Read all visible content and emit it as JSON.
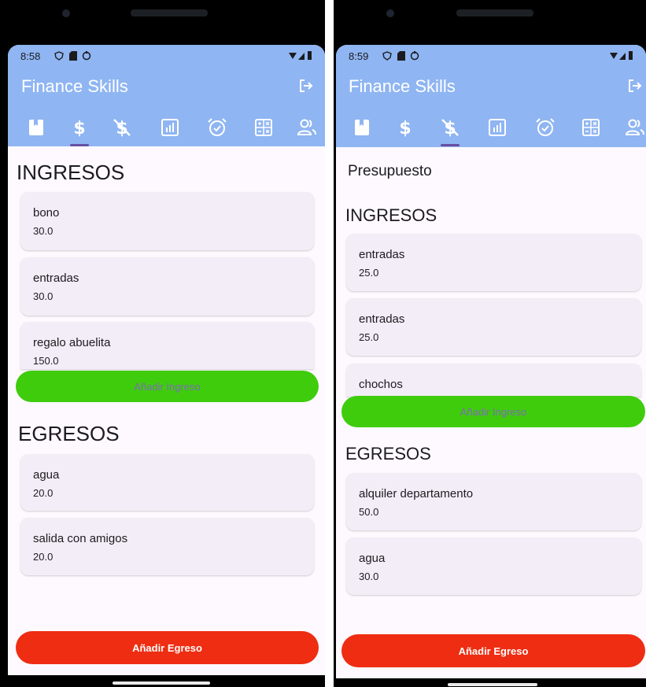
{
  "screens": [
    {
      "status_time": "8:58",
      "app_title": "Finance Skills",
      "tabs": [
        "book",
        "dollar",
        "money-off",
        "chart",
        "alarm",
        "calculator",
        "people"
      ],
      "active_tab": 1,
      "subtitle": "",
      "ingresos_title": "INGRESOS",
      "ingresos": [
        {
          "name": "bono",
          "amount": "30.0"
        },
        {
          "name": "entradas",
          "amount": "30.0"
        },
        {
          "name": "regalo abuelita",
          "amount": "150.0"
        }
      ],
      "add_ingreso_label": "Añadir Ingreso",
      "egresos_title": "EGRESOS",
      "egresos": [
        {
          "name": "agua",
          "amount": "20.0"
        },
        {
          "name": "salida con amigos",
          "amount": "20.0"
        }
      ],
      "add_egreso_label": "Añadir Egreso"
    },
    {
      "status_time": "8:59",
      "app_title": "Finance Skills",
      "tabs": [
        "book",
        "dollar",
        "money-off",
        "chart",
        "alarm",
        "calculator",
        "people"
      ],
      "active_tab": 2,
      "subtitle": "Presupuesto",
      "ingresos_title": "INGRESOS",
      "ingresos": [
        {
          "name": "entradas",
          "amount": "25.0"
        },
        {
          "name": "entradas",
          "amount": "25.0"
        },
        {
          "name": "chochos",
          "amount": ""
        }
      ],
      "add_ingreso_label": "Añadir Ingreso",
      "egresos_title": "EGRESOS",
      "egresos": [
        {
          "name": "alquiler departamento",
          "amount": "50.0"
        },
        {
          "name": "agua",
          "amount": "30.0"
        }
      ],
      "add_egreso_label": "Añadir Egreso"
    }
  ],
  "colors": {
    "app_bar": "#8fb5f2",
    "background": "#fdf9fe",
    "card": "#f3edf7",
    "add_ingreso": "#3fcc0d",
    "add_egreso": "#ee2d12",
    "tab_indicator": "#6750a4"
  }
}
